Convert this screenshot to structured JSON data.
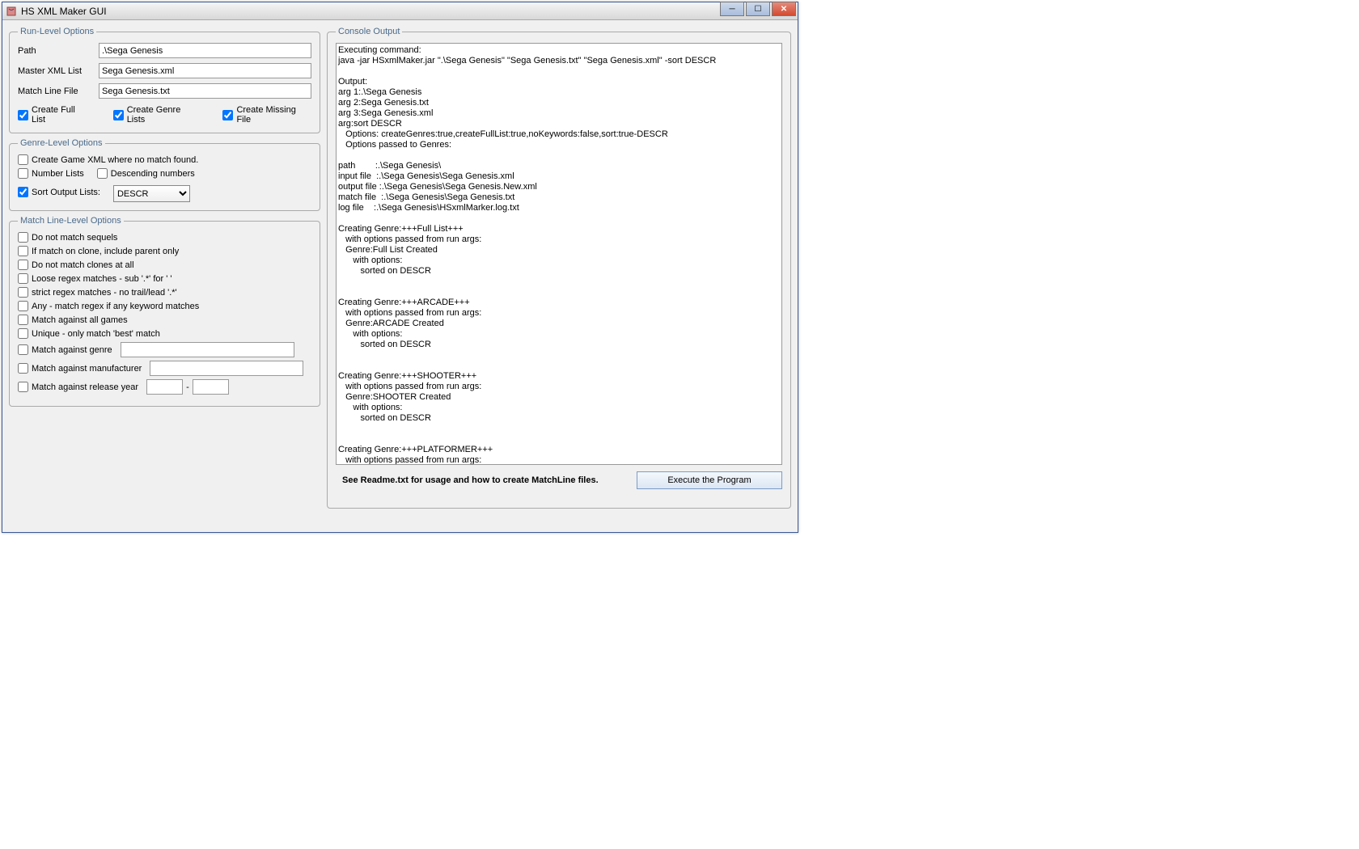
{
  "window": {
    "title": "HS XML Maker GUI"
  },
  "runLevel": {
    "legend": "Run-Level Options",
    "pathLabel": "Path",
    "pathValue": ".\\Sega Genesis",
    "masterLabel": "Master XML List",
    "masterValue": "Sega Genesis.xml",
    "matchLineLabel": "Match Line File",
    "matchLineValue": "Sega Genesis.txt",
    "cbFull": "Create Full List",
    "cbGenre": "Create Genre Lists",
    "cbMissing": "Create Missing File"
  },
  "genreLevel": {
    "legend": "Genre-Level Options",
    "cbNoMatch": "Create Game XML where no match found.",
    "cbNumber": "Number Lists",
    "cbDesc": "Descending numbers",
    "cbSort": "Sort Output Lists:",
    "sortValue": "DESCR"
  },
  "matchLevel": {
    "legend": "Match Line-Level Options",
    "cbSequels": "Do not match sequels",
    "cbClone": "If match on clone, include parent only",
    "cbNoClones": "Do not match clones at all",
    "cbLoose": "Loose regex matches - sub '.*' for ' '",
    "cbStrict": "strict regex matches - no trail/lead '.*'",
    "cbAny": "Any - match regex if any keyword matches",
    "cbAllGames": "Match against all games",
    "cbUnique": "Unique - only match 'best' match",
    "cbGenre": "Match against genre",
    "cbManu": "Match against manufacturer",
    "cbYear": "Match against release year",
    "dash": "-"
  },
  "console": {
    "legend": "Console Output",
    "text": "Executing command:\njava -jar HSxmlMaker.jar \".\\Sega Genesis\" \"Sega Genesis.txt\" \"Sega Genesis.xml\" -sort DESCR\n\nOutput:\narg 1:.\\Sega Genesis\narg 2:Sega Genesis.txt\narg 3:Sega Genesis.xml\narg:sort DESCR\n   Options: createGenres:true,createFullList:true,noKeywords:false,sort:true-DESCR\n   Options passed to Genres:\n\npath        :.\\Sega Genesis\\\ninput file  :.\\Sega Genesis\\Sega Genesis.xml\noutput file :.\\Sega Genesis\\Sega Genesis.New.xml\nmatch file  :.\\Sega Genesis\\Sega Genesis.txt\nlog file    :.\\Sega Genesis\\HSxmlMarker.log.txt\n\nCreating Genre:+++Full List+++\n   with options passed from run args:\n   Genre:Full List Created\n      with options:\n         sorted on DESCR\n\n\nCreating Genre:+++ARCADE+++\n   with options passed from run args:\n   Genre:ARCADE Created\n      with options:\n         sorted on DESCR\n\n\nCreating Genre:+++SHOOTER+++\n   with options passed from run args:\n   Genre:SHOOTER Created\n      with options:\n         sorted on DESCR\n\n\nCreating Genre:+++PLATFORMER+++\n   with options passed from run args:"
  },
  "footer": {
    "readme": "See Readme.txt for usage and how to create MatchLine files.",
    "execute": "Execute the Program"
  }
}
